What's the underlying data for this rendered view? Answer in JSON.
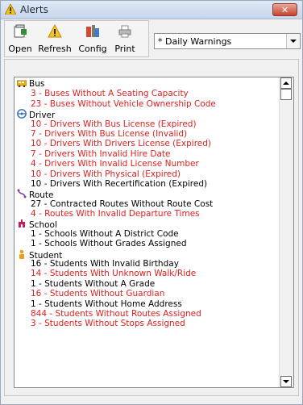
{
  "window": {
    "title": "Alerts",
    "close_label": "✕"
  },
  "toolbar": {
    "open": "Open",
    "refresh": "Refresh",
    "config": "Config",
    "print": "Print"
  },
  "filter": {
    "selected": "* Daily Warnings"
  },
  "colors": {
    "alert": "#e02020",
    "normal": "#000000"
  },
  "alerts": [
    {
      "kind": "category",
      "icon": "bus-icon",
      "label": "Bus"
    },
    {
      "kind": "item",
      "label": "3 - Buses Without A Seating Capacity",
      "color": "#e02020"
    },
    {
      "kind": "item",
      "label": "23 - Buses Without Vehicle Ownership Code",
      "color": "#e02020"
    },
    {
      "kind": "category",
      "icon": "driver-icon",
      "label": "Driver"
    },
    {
      "kind": "item",
      "label": "10 - Drivers With Bus License (Expired)",
      "color": "#e02020"
    },
    {
      "kind": "item",
      "label": "7 - Drivers With Bus License (Invalid)",
      "color": "#e02020"
    },
    {
      "kind": "item",
      "label": "10 - Drivers With Drivers License (Expired)",
      "color": "#e02020"
    },
    {
      "kind": "item",
      "label": "7 - Drivers With Invalid Hire Date",
      "color": "#e02020"
    },
    {
      "kind": "item",
      "label": "4 - Drivers With Invalid License Number",
      "color": "#e02020"
    },
    {
      "kind": "item",
      "label": "10 - Drivers With Physical (Expired)",
      "color": "#e02020"
    },
    {
      "kind": "item",
      "label": "10 - Drivers With Recertification (Expired)",
      "color": "#000000"
    },
    {
      "kind": "category",
      "icon": "route-icon",
      "label": "Route"
    },
    {
      "kind": "item",
      "label": "27 - Contracted Routes Without Route Cost",
      "color": "#000000"
    },
    {
      "kind": "item",
      "label": "4 - Routes With Invalid Departure Times",
      "color": "#e02020"
    },
    {
      "kind": "category",
      "icon": "school-icon",
      "label": "School"
    },
    {
      "kind": "item",
      "label": "1 - Schools Without A District Code",
      "color": "#000000"
    },
    {
      "kind": "item",
      "label": "1 - Schools Without Grades Assigned",
      "color": "#000000"
    },
    {
      "kind": "category",
      "icon": "student-icon",
      "label": "Student"
    },
    {
      "kind": "item",
      "label": "16 - Students With Invalid Birthday",
      "color": "#000000"
    },
    {
      "kind": "item",
      "label": "14 - Students With Unknown Walk/Ride",
      "color": "#e02020"
    },
    {
      "kind": "item",
      "label": "1 - Students Without A Grade",
      "color": "#000000"
    },
    {
      "kind": "item",
      "label": "16 - Students Without Guardian",
      "color": "#e02020"
    },
    {
      "kind": "item",
      "label": "1 - Students Without Home Address",
      "color": "#000000"
    },
    {
      "kind": "item",
      "label": "844 - Students Without Routes Assigned",
      "color": "#e02020"
    },
    {
      "kind": "item",
      "label": "3 - Students Without Stops Assigned",
      "color": "#e02020"
    }
  ]
}
